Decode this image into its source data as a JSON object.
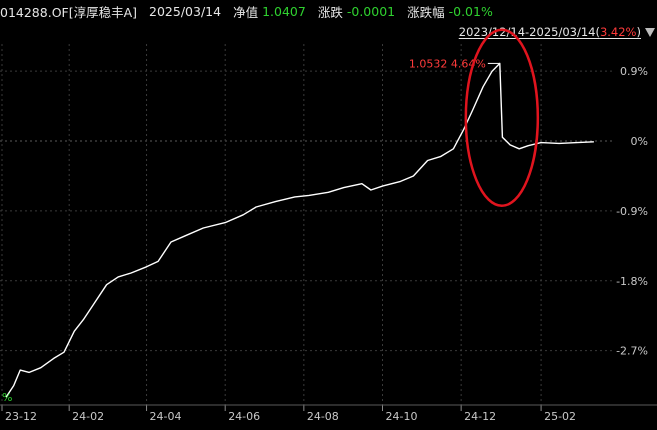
{
  "header": {
    "code": "014288.OF[淳厚稳丰A]",
    "date": "2025/03/14",
    "nav_label": "净值",
    "nav_value": "1.0407",
    "change_label": "涨跌",
    "change_value": "-0.0001",
    "change_pct_label": "涨跌幅",
    "change_pct_value": "-0.01%"
  },
  "range": {
    "text": "2023/12/14-2025/03/14(",
    "pct": "3.42%",
    "close": ")"
  },
  "annotation": {
    "peak_label": "1.0532 4.64%",
    "bottom_left_label": "%"
  },
  "colors": {
    "background": "#000000",
    "line": "#ffffff",
    "grid": "#3a3a3a",
    "zero_line": "#5a5a5a",
    "axis_text": "#c8c8c8",
    "up": "#ff3b3b",
    "down": "#2fd12f",
    "highlight_ellipse": "#e0141e"
  },
  "chart_data": {
    "type": "line",
    "title": "014288.OF[淳厚稳丰A]",
    "xlabel": "",
    "ylabel": "",
    "x_ticks": [
      "23-12",
      "24-02",
      "24-04",
      "24-06",
      "24-08",
      "24-10",
      "24-12",
      "25-02"
    ],
    "y_ticks": [
      "0.9%",
      "0%",
      "-0.9%",
      "-1.8%",
      "-2.7%"
    ],
    "y_tick_values": [
      0.9,
      0,
      -0.9,
      -1.8,
      -2.7
    ],
    "ylim": [
      -3.4,
      1.25
    ],
    "grid": true,
    "legend": "none",
    "peak": {
      "x": "2024-12-31",
      "y": 1.0,
      "label": "1.0532 4.64%"
    },
    "series": [
      {
        "values": [
          {
            "x": "2023-12-14",
            "y": -3.3
          },
          {
            "x": "2023-12-20",
            "y": -3.15
          },
          {
            "x": "2023-12-25",
            "y": -2.95
          },
          {
            "x": "2024-01-01",
            "y": -2.98
          },
          {
            "x": "2024-01-10",
            "y": -2.92
          },
          {
            "x": "2024-01-20",
            "y": -2.8
          },
          {
            "x": "2024-01-28",
            "y": -2.72
          },
          {
            "x": "2024-02-05",
            "y": -2.45
          },
          {
            "x": "2024-02-12",
            "y": -2.3
          },
          {
            "x": "2024-02-20",
            "y": -2.1
          },
          {
            "x": "2024-03-01",
            "y": -1.85
          },
          {
            "x": "2024-03-10",
            "y": -1.75
          },
          {
            "x": "2024-03-20",
            "y": -1.7
          },
          {
            "x": "2024-04-01",
            "y": -1.62
          },
          {
            "x": "2024-04-10",
            "y": -1.55
          },
          {
            "x": "2024-04-20",
            "y": -1.3
          },
          {
            "x": "2024-05-01",
            "y": -1.22
          },
          {
            "x": "2024-05-15",
            "y": -1.12
          },
          {
            "x": "2024-06-01",
            "y": -1.05
          },
          {
            "x": "2024-06-15",
            "y": -0.95
          },
          {
            "x": "2024-06-25",
            "y": -0.85
          },
          {
            "x": "2024-07-10",
            "y": -0.78
          },
          {
            "x": "2024-07-25",
            "y": -0.72
          },
          {
            "x": "2024-08-05",
            "y": -0.7
          },
          {
            "x": "2024-08-20",
            "y": -0.66
          },
          {
            "x": "2024-09-01",
            "y": -0.6
          },
          {
            "x": "2024-09-15",
            "y": -0.55
          },
          {
            "x": "2024-09-22",
            "y": -0.63
          },
          {
            "x": "2024-10-01",
            "y": -0.58
          },
          {
            "x": "2024-10-15",
            "y": -0.52
          },
          {
            "x": "2024-10-25",
            "y": -0.45
          },
          {
            "x": "2024-11-05",
            "y": -0.25
          },
          {
            "x": "2024-11-15",
            "y": -0.2
          },
          {
            "x": "2024-11-25",
            "y": -0.1
          },
          {
            "x": "2024-12-03",
            "y": 0.15
          },
          {
            "x": "2024-12-10",
            "y": 0.4
          },
          {
            "x": "2024-12-18",
            "y": 0.7
          },
          {
            "x": "2024-12-25",
            "y": 0.9
          },
          {
            "x": "2024-12-31",
            "y": 1.0
          },
          {
            "x": "2025-01-02",
            "y": 0.05
          },
          {
            "x": "2025-01-08",
            "y": -0.05
          },
          {
            "x": "2025-01-15",
            "y": -0.1
          },
          {
            "x": "2025-01-22",
            "y": -0.06
          },
          {
            "x": "2025-02-01",
            "y": -0.02
          },
          {
            "x": "2025-02-15",
            "y": -0.03
          },
          {
            "x": "2025-03-01",
            "y": -0.02
          },
          {
            "x": "2025-03-14",
            "y": -0.01
          }
        ]
      }
    ]
  }
}
